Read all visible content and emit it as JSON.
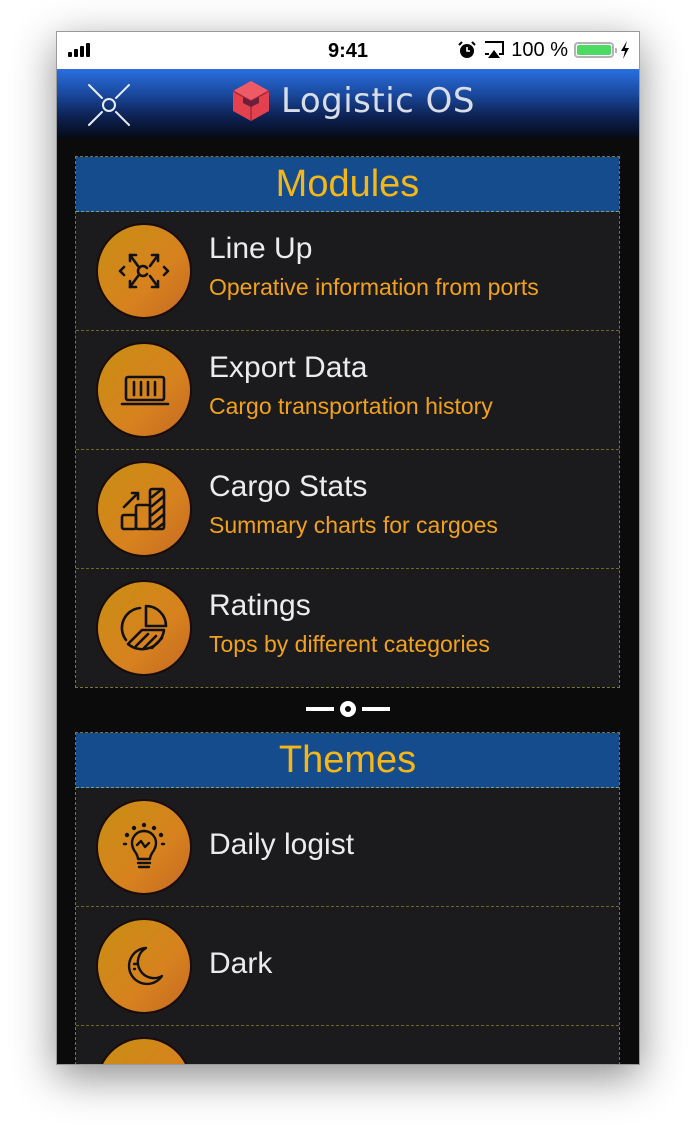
{
  "status_bar": {
    "time": "9:41",
    "battery_percent": "100 %",
    "battery_level": 1.0,
    "icons": [
      "signal-icon",
      "alarm-icon",
      "airplay-icon",
      "battery-icon",
      "charging-bolt-icon"
    ]
  },
  "navbar": {
    "menu_icon": "menu-x-icon",
    "logo_icon": "cube-logo-icon",
    "title": "Logistic OS"
  },
  "colors": {
    "section_header_bg": "#154c8e",
    "section_title": "#f5b617",
    "subtitle": "#f2a21a",
    "row_bg": "#1b1b1e",
    "icon_circle": "#d08a1a",
    "logo_red": "#e4414f"
  },
  "modules": {
    "title": "Modules",
    "items": [
      {
        "title": "Line Up",
        "subtitle": "Operative information from ports",
        "icon": "network-arrows-icon"
      },
      {
        "title": "Export Data",
        "subtitle": "Cargo transportation history",
        "icon": "container-icon"
      },
      {
        "title": "Cargo Stats",
        "subtitle": "Summary charts for cargoes",
        "icon": "bar-chart-icon"
      },
      {
        "title": "Ratings",
        "subtitle": "Tops by different categories",
        "icon": "pie-chart-icon"
      }
    ]
  },
  "separator_icon": "divider-dot-icon",
  "themes": {
    "title": "Themes",
    "items": [
      {
        "title": "Daily logist",
        "icon": "lightbulb-icon"
      },
      {
        "title": "Dark",
        "icon": "moon-icon"
      },
      {
        "title": "",
        "icon": "theme-icon"
      }
    ]
  }
}
